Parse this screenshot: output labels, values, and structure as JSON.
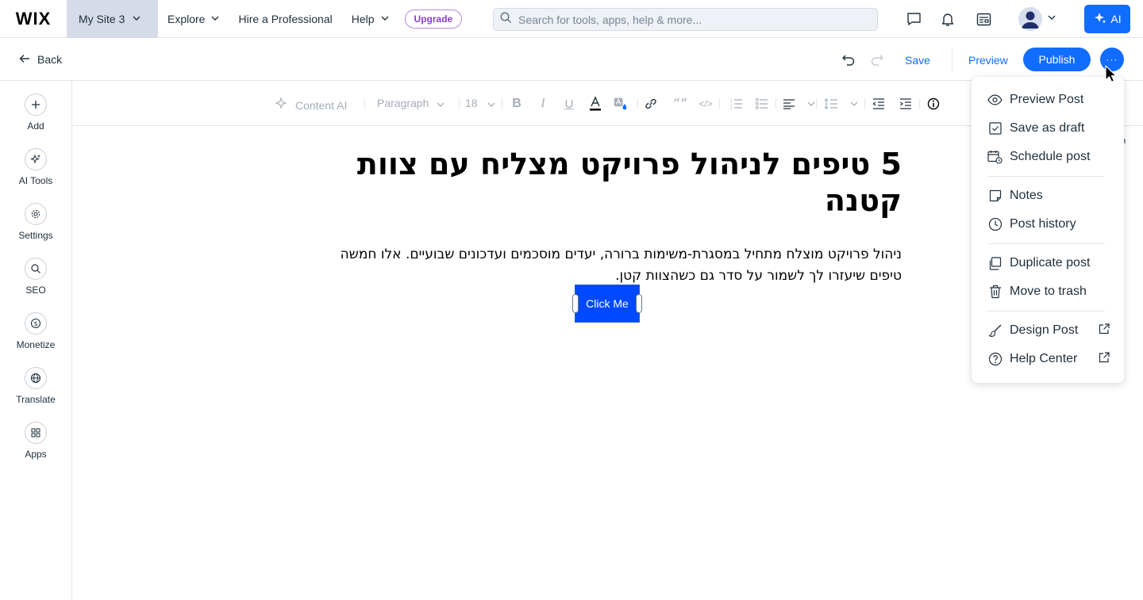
{
  "topbar": {
    "logo": "WIX",
    "site_name": "My Site 3",
    "nav": [
      {
        "label": "Explore"
      },
      {
        "label": "Hire a Professional"
      },
      {
        "label": "Help"
      }
    ],
    "upgrade_label": "Upgrade",
    "search_placeholder": "Search for tools, apps, help & more...",
    "ai_label": "AI"
  },
  "editor_bar": {
    "back_label": "Back",
    "save_label": "Save",
    "preview_label": "Preview",
    "publish_label": "Publish",
    "more_label": "···"
  },
  "sidebar": {
    "items": [
      {
        "label": "Add",
        "icon": "plus-icon"
      },
      {
        "label": "AI Tools",
        "icon": "sparkle-icon"
      },
      {
        "label": "Settings",
        "icon": "gear-icon"
      },
      {
        "label": "SEO",
        "icon": "search-icon"
      },
      {
        "label": "Monetize",
        "icon": "dollar-icon"
      },
      {
        "label": "Translate",
        "icon": "globe-icon"
      },
      {
        "label": "Apps",
        "icon": "apps-icon"
      }
    ]
  },
  "toolbar": {
    "content_ai_label": "Content AI",
    "paragraph_label": "Paragraph",
    "font_size": "18"
  },
  "post": {
    "title": "5 טיפים לניהול פרויקט מצליח עם צוות קטנה",
    "body": "ניהול פרויקט מוצלח מתחיל במסגרת-משימות ברורה, יעדים מוסכמים ועדכונים שבועיים. אלו חמשה טיפים שיעזרו לך לשמור על סדר גם כשהצוות קטן.",
    "button_label": "Click Me"
  },
  "menu": {
    "items": [
      {
        "label": "Preview Post",
        "icon": "eye-icon"
      },
      {
        "label": "Save as draft",
        "icon": "checkbox-icon"
      },
      {
        "label": "Schedule post",
        "icon": "calendar-icon"
      },
      {
        "label": "Notes",
        "icon": "note-icon"
      },
      {
        "label": "Post history",
        "icon": "clock-icon"
      },
      {
        "label": "Duplicate post",
        "icon": "duplicate-icon"
      },
      {
        "label": "Move to trash",
        "icon": "trash-icon"
      },
      {
        "label": "Design Post",
        "icon": "brush-icon"
      },
      {
        "label": "Help Center",
        "icon": "help-icon"
      }
    ]
  },
  "colors": {
    "accent": "#116dff",
    "site_menu_bg": "#d6dbe8",
    "upgrade": "#8a3dc9",
    "cta_button": "#0049ff"
  }
}
